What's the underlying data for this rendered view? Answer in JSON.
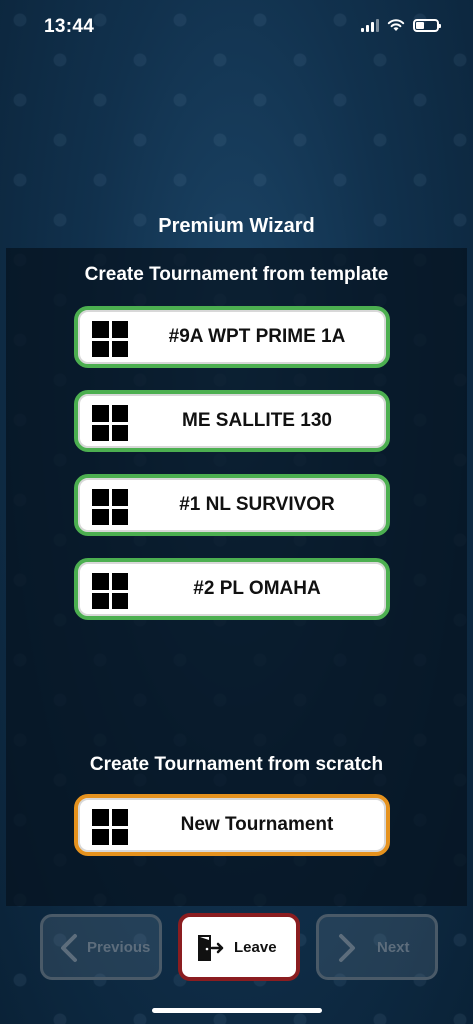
{
  "status_bar": {
    "time": "13:44"
  },
  "wizard": {
    "title": "Premium Wizard"
  },
  "template_section": {
    "title": "Create Tournament from template",
    "items": [
      {
        "label": "#9A WPT PRIME 1A"
      },
      {
        "label": "ME SALLITE 130"
      },
      {
        "label": "#1 NL SURVIVOR"
      },
      {
        "label": "#2 PL OMAHA"
      }
    ],
    "accent_color": "#4caf50"
  },
  "scratch_section": {
    "title": "Create Tournament from scratch",
    "new_label": "New Tournament",
    "accent_color": "#e5921e"
  },
  "navigation": {
    "previous_label": "Previous",
    "leave_label": "Leave",
    "next_label": "Next",
    "leave_color": "#8b1d20"
  }
}
